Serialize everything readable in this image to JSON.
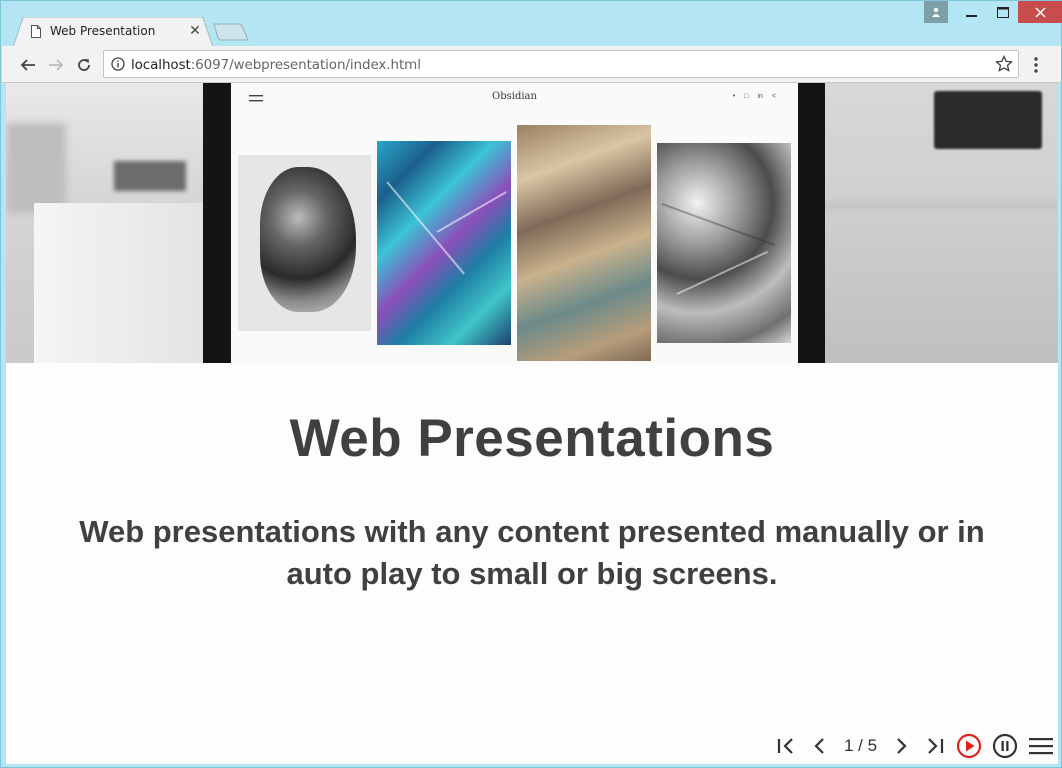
{
  "browser": {
    "tab_title": "Web Presentation",
    "url_host": "localhost",
    "url_rest": ":6097/webpresentation/index.html"
  },
  "site_mockup": {
    "brand": "Obsidian",
    "social_icons": [
      "twitter-icon",
      "instagram-icon",
      "linkedin-icon",
      "share-icon"
    ],
    "social_glyphs": [
      "•",
      "□",
      "in",
      "<"
    ]
  },
  "slide": {
    "title": "Web Presentations",
    "subtitle": "Web presentations with any content presented manually or in auto play to small or big screens."
  },
  "controls": {
    "current": 1,
    "total": 5,
    "counter_text": "1 / 5",
    "play_color": "#e0201c"
  }
}
